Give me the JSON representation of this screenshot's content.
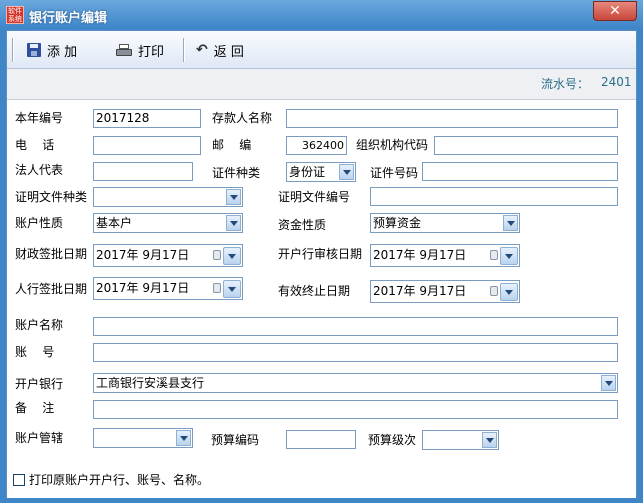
{
  "window": {
    "title": "银行账户编辑",
    "app_icon_text": "软件 系统",
    "close_glyph": "✕"
  },
  "toolbar": {
    "add_label": "添 加",
    "print_label": "打印",
    "back_label": "返 回",
    "back_glyph": "↶"
  },
  "serial": {
    "label": "流水号：",
    "value": "2401"
  },
  "form": {
    "year_no": {
      "label": "本年编号",
      "value": "2017128"
    },
    "depositor_name": {
      "label": "存款人名称",
      "value": ""
    },
    "phone": {
      "label": "电    话",
      "value": ""
    },
    "postcode": {
      "label": "邮    编",
      "value": "362400"
    },
    "org_code": {
      "label": "组织机构代码",
      "value": ""
    },
    "legal_rep": {
      "label": "法人代表",
      "value": ""
    },
    "id_type": {
      "label": "证件种类",
      "value": "身份证"
    },
    "id_no": {
      "label": "证件号码",
      "value": ""
    },
    "doc_type": {
      "label": "证明文件种类",
      "value": ""
    },
    "doc_no": {
      "label": "证明文件编号",
      "value": ""
    },
    "account_nature": {
      "label": "账户性质",
      "value": "基本户"
    },
    "fund_nature": {
      "label": "资金性质",
      "value": "预算资金"
    },
    "finance_date": {
      "label": "财政签批日期",
      "value": "2017年 9月17日"
    },
    "bank_review_date": {
      "label": "开户行审核日期",
      "value": "2017年 9月17日"
    },
    "pboc_date": {
      "label": "人行签批日期",
      "value": "2017年 9月17日"
    },
    "expiry_date": {
      "label": "有效终止日期",
      "value": "2017年 9月17日"
    },
    "account_name": {
      "label": "账户名称",
      "value": ""
    },
    "account_no": {
      "label": "账    号",
      "value": ""
    },
    "bank": {
      "label": "开户银行",
      "value": "工商银行安溪县支行"
    },
    "remark": {
      "label": "备    注",
      "value": ""
    },
    "jurisdiction": {
      "label": "账户管辖",
      "value": ""
    },
    "budget_code": {
      "label": "预算编码",
      "value": ""
    },
    "budget_level": {
      "label": "预算级次",
      "value": ""
    },
    "print_original": {
      "label": "打印原账户开户行、账号、名称。",
      "checked": false
    }
  }
}
